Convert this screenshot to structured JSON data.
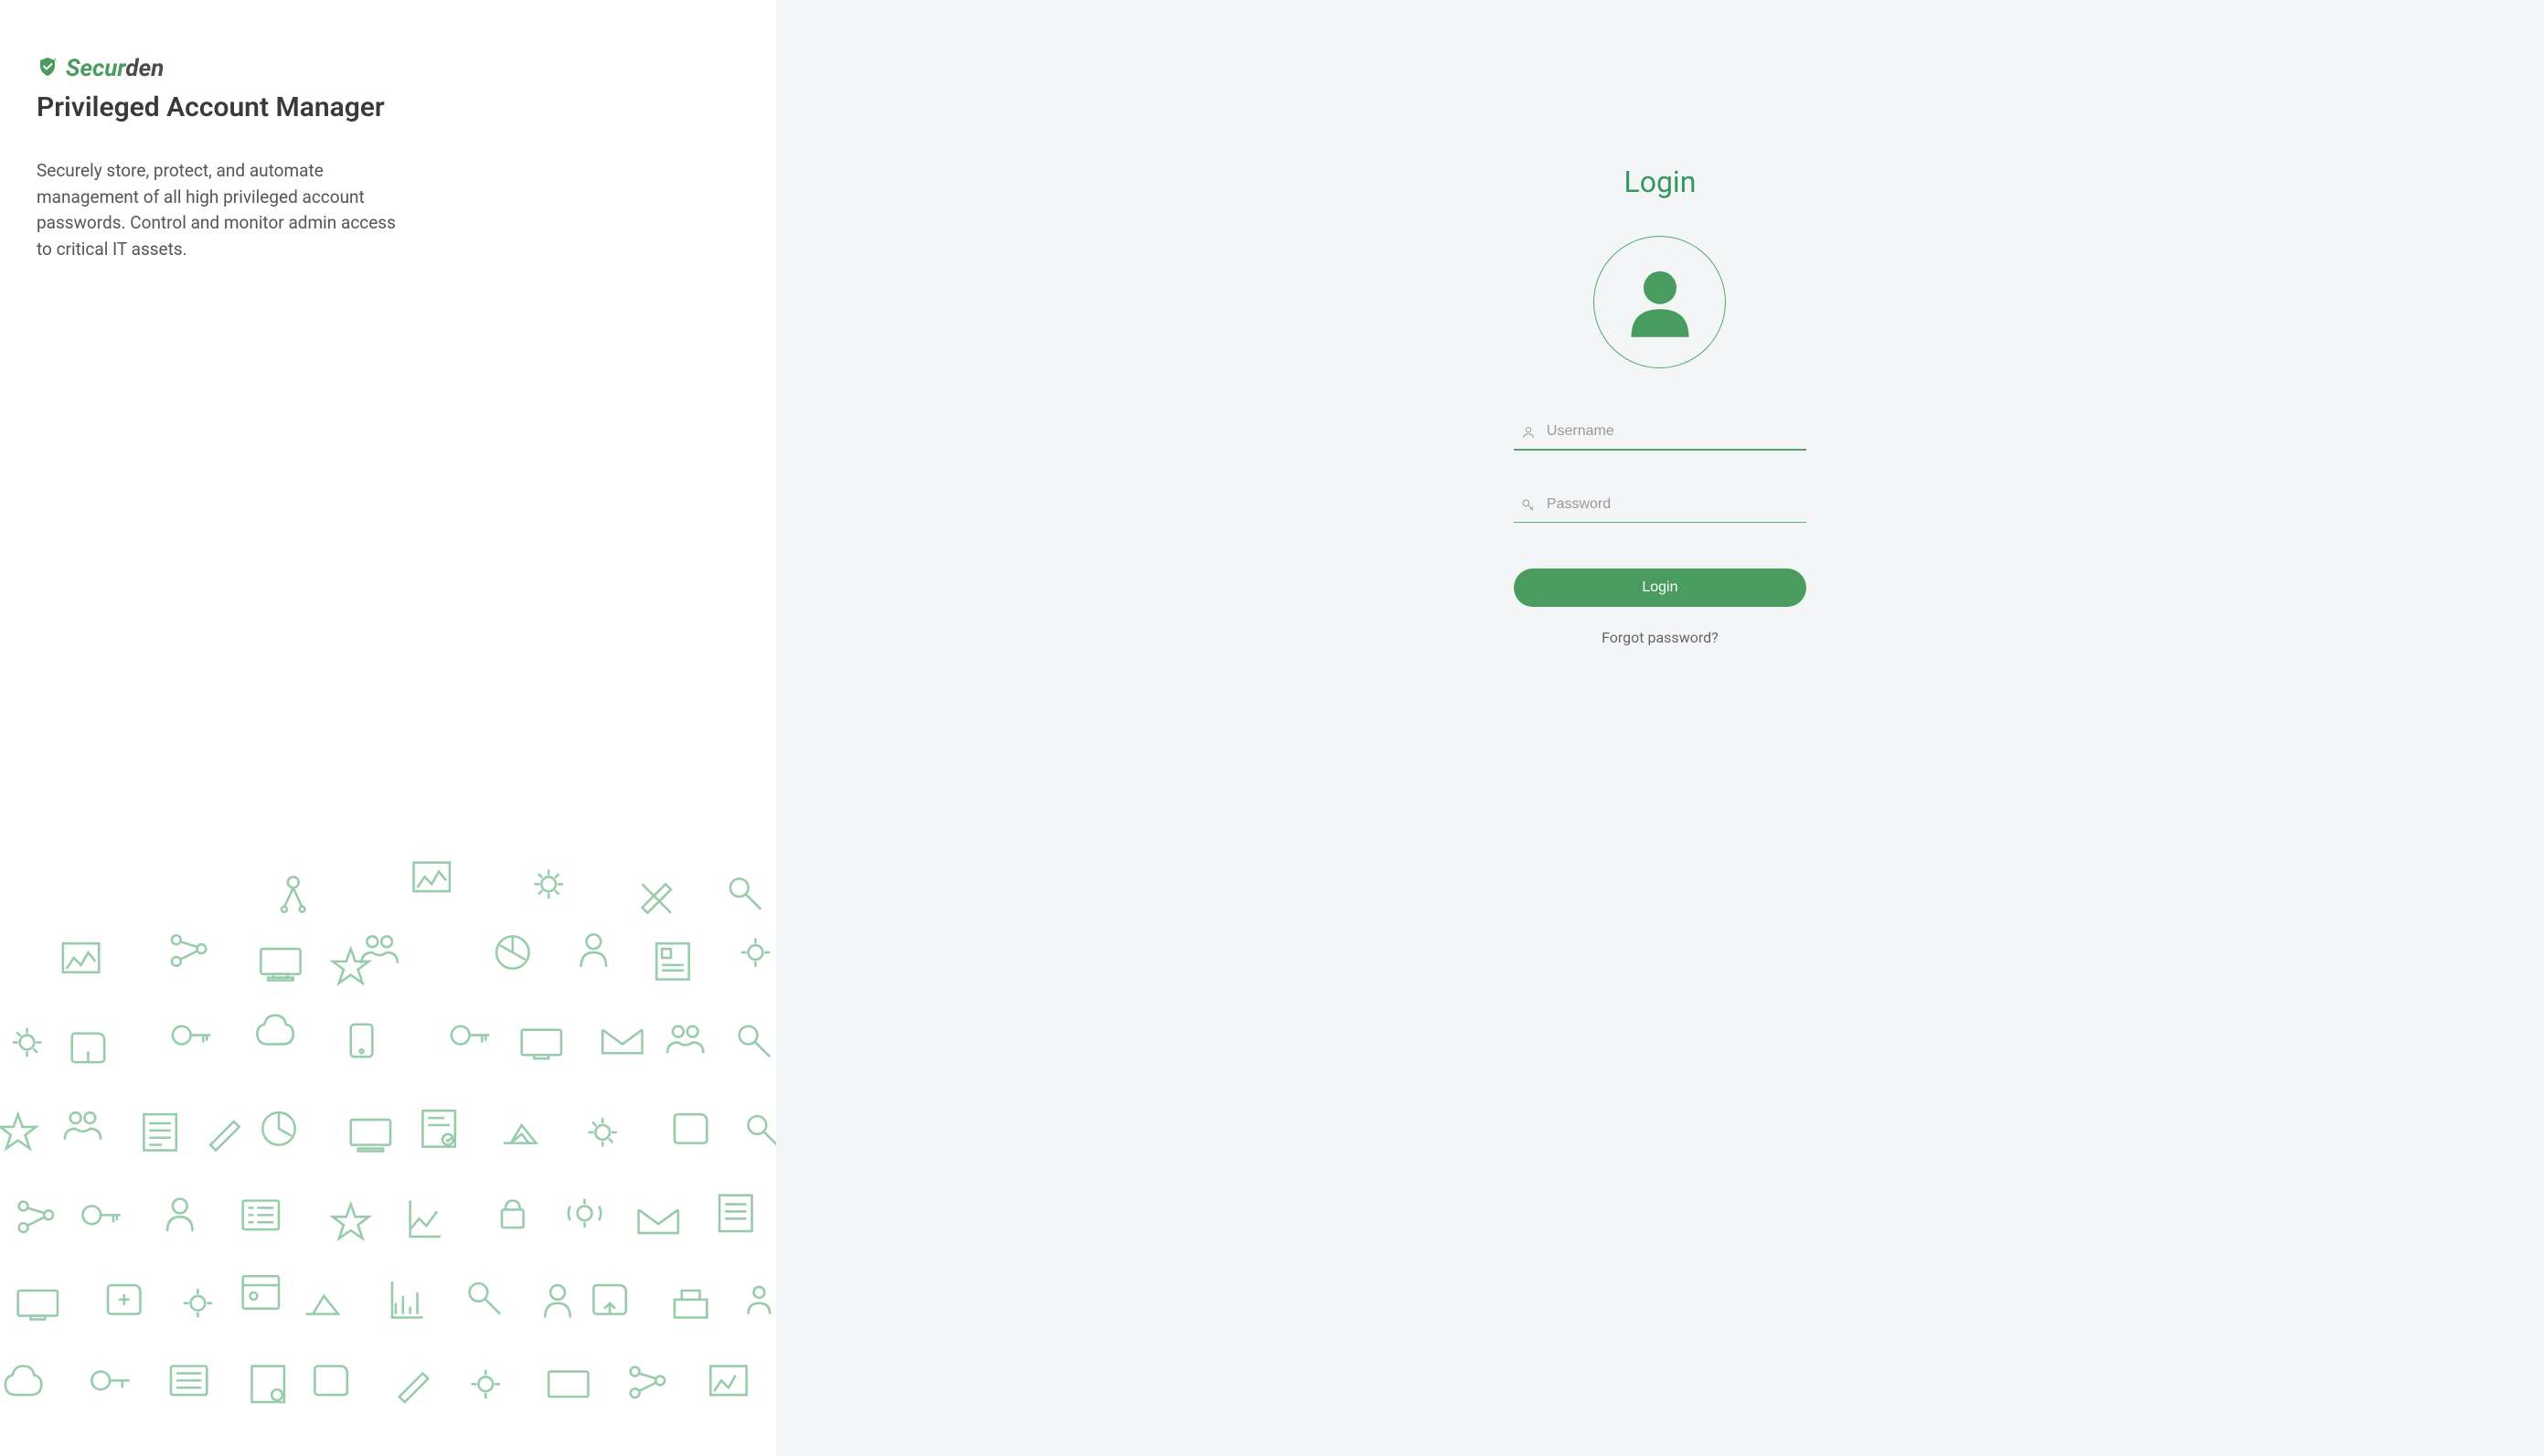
{
  "branding": {
    "logo_part1": "Secur",
    "logo_part2": "den",
    "product_title": "Privileged Account Manager",
    "product_description": "Securely store, protect, and automate management of all high privileged account passwords. Control and monitor admin access to critical IT assets."
  },
  "login": {
    "heading": "Login",
    "username_placeholder": "Username",
    "username_value": "",
    "password_placeholder": "Password",
    "password_value": "",
    "button_label": "Login",
    "forgot_label": "Forgot password?"
  },
  "colors": {
    "accent": "#4a9b5f",
    "accent_light": "#5cb37a",
    "bg_right": "#f4f5f6"
  }
}
